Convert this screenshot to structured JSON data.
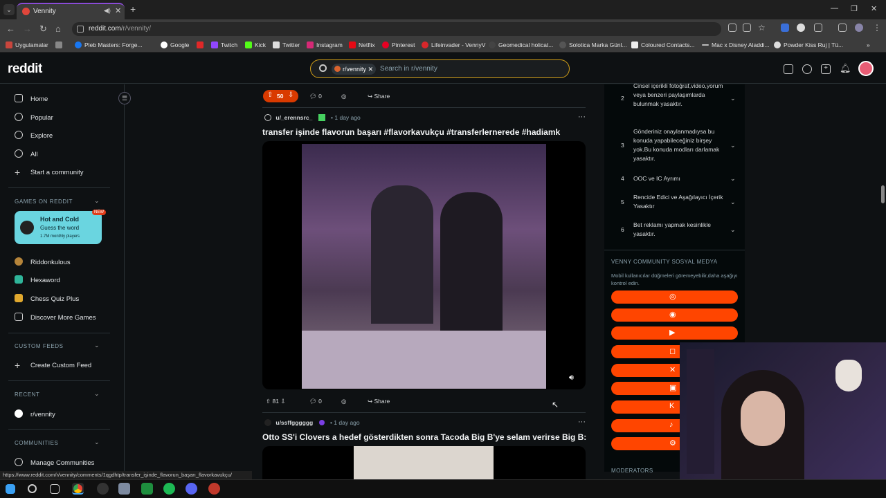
{
  "browser": {
    "tab_title": "Vennity",
    "url_host": "reddit.com",
    "url_path": "/r/vennity/",
    "status_url": "https://www.reddit.com/r/vennity/comments/1qgdhtp/transfer_işinde_flavorun_başarı_flavorkavukçu/"
  },
  "bookmarks": [
    "Uygulamalar",
    "Pleb Masters: Forge...",
    "Google",
    "Twitch",
    "Kick",
    "Twitter",
    "Instagram",
    "Netflix",
    "Pinterest",
    "Lifeinvader - VennyV",
    "Geomedical holicat...",
    "Solotica Marka Günl...",
    "Coloured Contacts...",
    "Mac x Disney Aladdi...",
    "Powder Kiss Ruj | Tü..."
  ],
  "header": {
    "logo": "reddit",
    "search_chip": "r/vennity",
    "search_placeholder": "Search in r/vennity"
  },
  "left_nav": {
    "main": [
      "Home",
      "Popular",
      "Explore",
      "All",
      "Start a community"
    ],
    "games_section": "GAMES ON REDDIT",
    "featured_game": {
      "name": "Hot and Cold",
      "tagline": "Guess the word",
      "players": "1.7M monthly players",
      "badge": "NEW"
    },
    "games": [
      "Riddonkulous",
      "Hexaword",
      "Chess Quiz Plus",
      "Discover More Games"
    ],
    "custom_feeds_section": "CUSTOM FEEDS",
    "create_feed": "Create Custom Feed",
    "recent_section": "RECENT",
    "recent": [
      "r/vennity"
    ],
    "communities_section": "COMMUNITIES",
    "manage": "Manage Communities"
  },
  "feed": {
    "prev_post": {
      "votes": "50",
      "comments": "0",
      "share": "Share"
    },
    "post1": {
      "author": "u/_erennsrc_",
      "time": "1 day ago",
      "title": "transfer işinde flavorun başarı #flavorkavukçu #transferlernerede #hadiamk",
      "votes": "81",
      "comments": "0",
      "share": "Share"
    },
    "post2": {
      "author": "u/ssffgggggg",
      "time": "1 day ago",
      "title": "Otto SS'i Clovers a hedef gösterdikten sonra Tacoda Big B'ye selam verirse Big B:"
    }
  },
  "rules": [
    {
      "n": "2",
      "text": "Cinsel içerikli fotoğraf,video,yorum veya benzeri paylaşımlarda bulunmak yasaktır."
    },
    {
      "n": "3",
      "text": "Gönderiniz onaylanmadıysa bu konuda yapabileceğiniz birşey yok.Bu konuda modları darlamak yasaktır."
    },
    {
      "n": "4",
      "text": "OOC ve IC Ayrımı"
    },
    {
      "n": "5",
      "text": "Rencide Edici ve Aşağılayıcı İçerik Yasaktır"
    },
    {
      "n": "6",
      "text": "Bet reklamı yapmak kesinlikle yasaktır."
    }
  ],
  "social": {
    "heading": "VENNY COMMUNITY SOSYAL MEDYA",
    "desc": "Mobil kullanıcılar düğmeleri göremeyebilir,daha aşağıyı kontrol edin.",
    "buttons": [
      "globe-icon",
      "discord-icon",
      "youtube-icon",
      "instagram-icon",
      "x-icon",
      "twitch-icon",
      "kick-icon",
      "tiktok-icon",
      "steam-icon"
    ]
  },
  "moderators_heading": "MODERATORS",
  "colors": {
    "accent": "#ff4500",
    "upvote": "#d93a00",
    "search_border": "#d4a017"
  }
}
